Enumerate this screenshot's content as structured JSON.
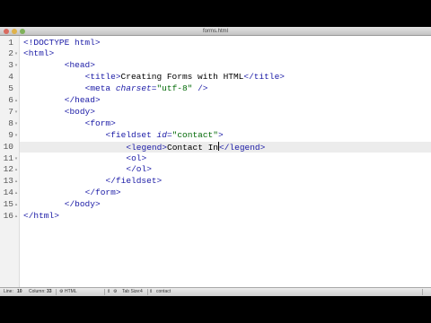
{
  "window": {
    "title": "forms.html"
  },
  "editor": {
    "current_line": 10,
    "lines": [
      {
        "n": "1",
        "indent": 0,
        "fold": "",
        "parts": [
          [
            "tag",
            "<!DOCTYPE html>"
          ]
        ]
      },
      {
        "n": "2",
        "indent": 0,
        "fold": "▾",
        "parts": [
          [
            "tag",
            "<html>"
          ]
        ]
      },
      {
        "n": "3",
        "indent": 8,
        "fold": "▾",
        "parts": [
          [
            "tag",
            "<head>"
          ]
        ]
      },
      {
        "n": "4",
        "indent": 12,
        "fold": "",
        "parts": [
          [
            "tag",
            "<title>"
          ],
          [
            "text",
            "Creating Forms with HTML"
          ],
          [
            "tag",
            "</title>"
          ]
        ]
      },
      {
        "n": "5",
        "indent": 12,
        "fold": "",
        "parts": [
          [
            "tag",
            "<meta "
          ],
          [
            "attr",
            "charset"
          ],
          [
            "tag",
            "="
          ],
          [
            "val",
            "\"utf-8\""
          ],
          [
            "tag",
            " />"
          ]
        ]
      },
      {
        "n": "6",
        "indent": 8,
        "fold": "▴",
        "parts": [
          [
            "tag",
            "</head>"
          ]
        ]
      },
      {
        "n": "7",
        "indent": 8,
        "fold": "▾",
        "parts": [
          [
            "tag",
            "<body>"
          ]
        ]
      },
      {
        "n": "8",
        "indent": 12,
        "fold": "▾",
        "parts": [
          [
            "tag",
            "<form>"
          ]
        ]
      },
      {
        "n": "9",
        "indent": 16,
        "fold": "▾",
        "parts": [
          [
            "tag",
            "<fieldset "
          ],
          [
            "attr",
            "id"
          ],
          [
            "tag",
            "="
          ],
          [
            "val",
            "\"contact\""
          ],
          [
            "tag",
            ">"
          ]
        ]
      },
      {
        "n": "10",
        "indent": 20,
        "fold": "",
        "parts": [
          [
            "tag",
            "<legend>"
          ],
          [
            "text",
            "Contact In"
          ],
          [
            "caret",
            ""
          ],
          [
            "tag",
            "</legend>"
          ]
        ]
      },
      {
        "n": "11",
        "indent": 20,
        "fold": "▾",
        "parts": [
          [
            "tag",
            "<ol>"
          ]
        ]
      },
      {
        "n": "12",
        "indent": 20,
        "fold": "▴",
        "parts": [
          [
            "tag",
            "</ol>"
          ]
        ]
      },
      {
        "n": "13",
        "indent": 16,
        "fold": "▴",
        "parts": [
          [
            "tag",
            "</fieldset>"
          ]
        ]
      },
      {
        "n": "14",
        "indent": 12,
        "fold": "▴",
        "parts": [
          [
            "tag",
            "</form>"
          ]
        ]
      },
      {
        "n": "15",
        "indent": 8,
        "fold": "▴",
        "parts": [
          [
            "tag",
            "</body>"
          ]
        ]
      },
      {
        "n": "16",
        "indent": 0,
        "fold": "▴",
        "parts": [
          [
            "tag",
            "</html>"
          ]
        ]
      }
    ]
  },
  "status": {
    "line_label": "Line:",
    "line_value": "10",
    "column_label": "Column:",
    "column_value": "33",
    "language": "HTML",
    "tab_size_label": "Tab Size:",
    "tab_size_value": "4",
    "symbol": "contact"
  },
  "colors": {
    "tag": "#1a1aa6",
    "string": "#036a07",
    "current_line": "#ececec"
  }
}
